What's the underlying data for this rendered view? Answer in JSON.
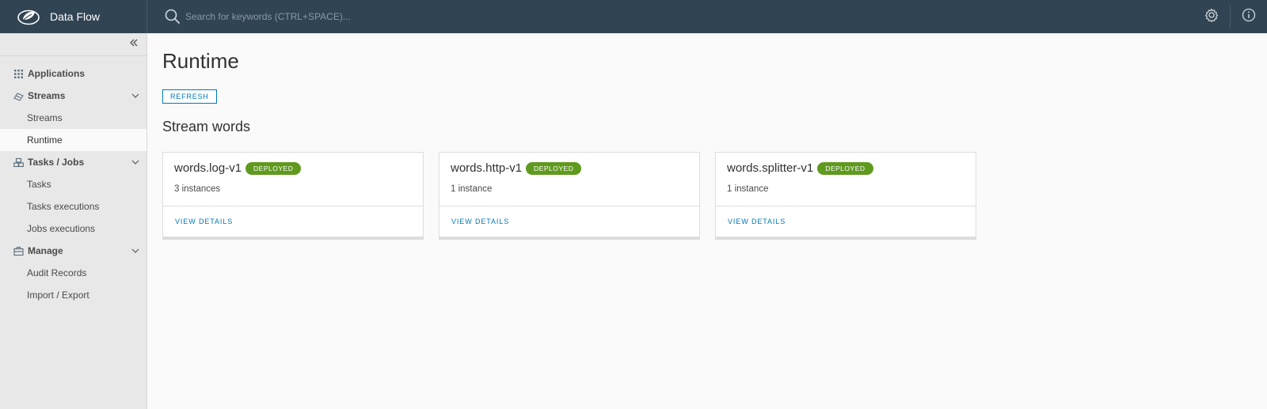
{
  "header": {
    "app_title": "Data Flow",
    "logo_icon": "spring-leaf-icon",
    "search_placeholder": "Search for keywords (CTRL+SPACE)...",
    "settings_icon": "gear-icon",
    "info_icon": "info-icon"
  },
  "sidebar": {
    "collapse_icon": "double-chevron-left-icon",
    "groups": [
      {
        "label": "Applications",
        "icon": "grid-icon",
        "expandable": false,
        "items": []
      },
      {
        "label": "Streams",
        "icon": "streams-icon",
        "expandable": true,
        "items": [
          {
            "label": "Streams",
            "active": false
          },
          {
            "label": "Runtime",
            "active": true
          }
        ]
      },
      {
        "label": "Tasks / Jobs",
        "icon": "tasks-icon",
        "expandable": true,
        "items": [
          {
            "label": "Tasks",
            "active": false
          },
          {
            "label": "Tasks executions",
            "active": false
          },
          {
            "label": "Jobs executions",
            "active": false
          }
        ]
      },
      {
        "label": "Manage",
        "icon": "briefcase-icon",
        "expandable": true,
        "items": [
          {
            "label": "Audit Records",
            "active": false
          },
          {
            "label": "Import / Export",
            "active": false
          }
        ]
      }
    ]
  },
  "main": {
    "title": "Runtime",
    "refresh_label": "REFRESH",
    "section_title": "Stream words",
    "cards": [
      {
        "name": "words.log-v1",
        "status": "DEPLOYED",
        "instances": "3 instances",
        "link": "VIEW DETAILS"
      },
      {
        "name": "words.http-v1",
        "status": "DEPLOYED",
        "instances": "1 instance",
        "link": "VIEW DETAILS"
      },
      {
        "name": "words.splitter-v1",
        "status": "DEPLOYED",
        "instances": "1 instance",
        "link": "VIEW DETAILS"
      }
    ]
  },
  "colors": {
    "header_bg": "#314454",
    "accent": "#0079b8",
    "deployed_badge": "#5f9a1e",
    "sidebar_bg": "#e8e8e8"
  }
}
